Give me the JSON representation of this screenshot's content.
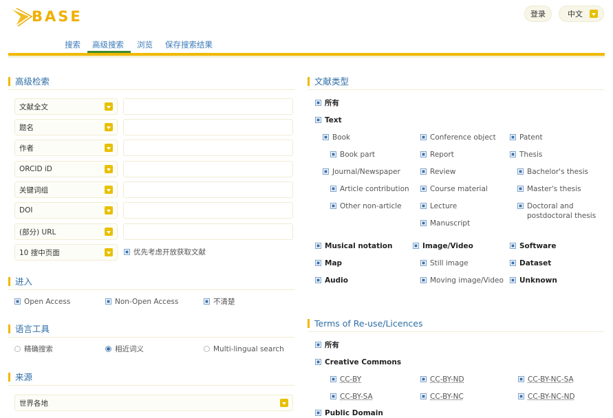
{
  "header": {
    "logo_text": "BASE",
    "login_label": "登录",
    "language_label": "中文"
  },
  "nav": {
    "tabs": [
      {
        "label": "搜索",
        "active": false
      },
      {
        "label": "高级搜索",
        "active": true
      },
      {
        "label": "浏览",
        "active": false
      },
      {
        "label": "保存搜索结果",
        "active": false
      }
    ]
  },
  "advanced_search": {
    "title": "高级检索",
    "fields": [
      {
        "select_label": "文献全文",
        "value": ""
      },
      {
        "select_label": "题名",
        "value": ""
      },
      {
        "select_label": "作者",
        "value": ""
      },
      {
        "select_label": "ORCID iD",
        "value": ""
      },
      {
        "select_label": "关键词组",
        "value": ""
      },
      {
        "select_label": "DOI",
        "value": ""
      },
      {
        "select_label": "(部分) URL",
        "value": ""
      }
    ],
    "hits_select": "10 搜中页面",
    "open_access_first": "优先考虑开放获取文献"
  },
  "access": {
    "title": "进入",
    "options": [
      "Open Access",
      "Non-Open Access",
      "不清楚"
    ]
  },
  "language_tools": {
    "title": "语言工具",
    "options": [
      "精确搜索",
      "相近词义",
      "Multi-lingual search"
    ],
    "selected": "相近词义"
  },
  "source": {
    "title": "来源",
    "select_value": "世界各地"
  },
  "doc_types": {
    "title": "文献类型",
    "all": "所有",
    "text": "Text",
    "col1": [
      "Book",
      "Book part",
      "Journal/Newspaper",
      "Article contribution",
      "Other non-article"
    ],
    "col2": [
      "Conference object",
      "Report",
      "Review",
      "Course material",
      "Lecture",
      "Manuscript"
    ],
    "col3": [
      "Patent",
      "Thesis",
      "Bachelor's thesis",
      "Master's thesis",
      "Doctoral and postdoctoral thesis"
    ],
    "other": [
      "Musical notation",
      "Image/Video",
      "Software",
      "Map",
      "Still image",
      "Dataset",
      "Audio",
      "Moving image/Video",
      "Unknown"
    ]
  },
  "licences": {
    "title": "Terms of Re-use/Licences",
    "all": "所有",
    "cc": "Creative Commons",
    "items": [
      "CC-BY",
      "CC-BY-ND",
      "CC-BY-NC-SA",
      "CC-BY-SA",
      "CC-BY-NC",
      "CC-BY-NC-ND"
    ],
    "public_domain": "Public Domain"
  },
  "colors": {
    "accent": "#f0b800",
    "link": "#2e6ea6",
    "active_underline": "#3e8a2e"
  }
}
